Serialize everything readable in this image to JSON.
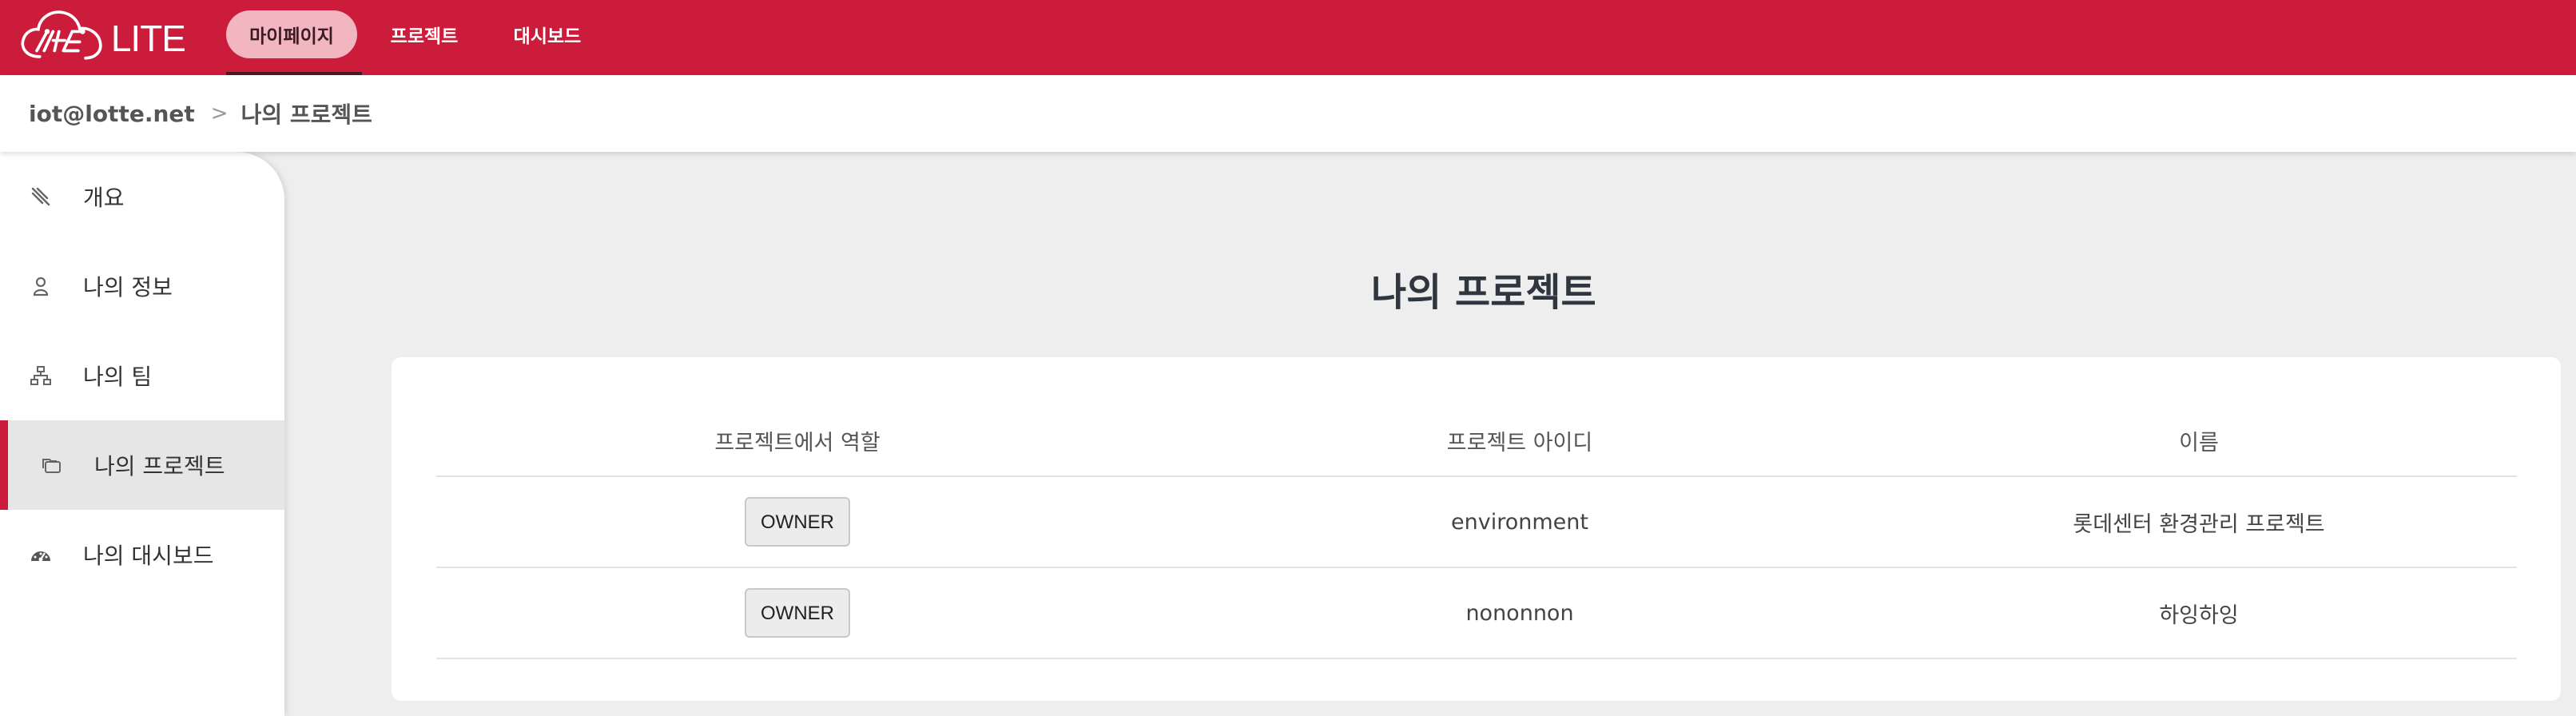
{
  "app": {
    "logo_text": "LITE"
  },
  "topnav": {
    "tabs": [
      {
        "label": "마이페이지",
        "active": true
      },
      {
        "label": "프로젝트",
        "active": false
      },
      {
        "label": "대시보드",
        "active": false
      }
    ]
  },
  "breadcrumb": {
    "user": "iot@lotte.net",
    "separator": ">",
    "current": "나의 프로젝트"
  },
  "sidebar": {
    "items": [
      {
        "label": "개요",
        "icon": "pin-icon",
        "active": false
      },
      {
        "label": "나의 정보",
        "icon": "user-icon",
        "active": false
      },
      {
        "label": "나의 팀",
        "icon": "sitemap-icon",
        "active": false
      },
      {
        "label": "나의 프로젝트",
        "icon": "folders-icon",
        "active": true
      },
      {
        "label": "나의 대시보드",
        "icon": "dashboard-icon",
        "active": false
      }
    ]
  },
  "main": {
    "title": "나의 프로젝트",
    "table": {
      "headers": [
        "프로젝트에서 역할",
        "프로젝트 아이디",
        "이름"
      ],
      "rows": [
        {
          "role": "OWNER",
          "project_id": "environment",
          "name": "롯데센터 환경관리 프로젝트"
        },
        {
          "role": "OWNER",
          "project_id": "nononnon",
          "name": "하잉하잉"
        }
      ]
    }
  },
  "colors": {
    "brand": "#cc1c3b",
    "active_tab_bg": "#f2b6c0",
    "page_bg": "#eeeeee"
  }
}
